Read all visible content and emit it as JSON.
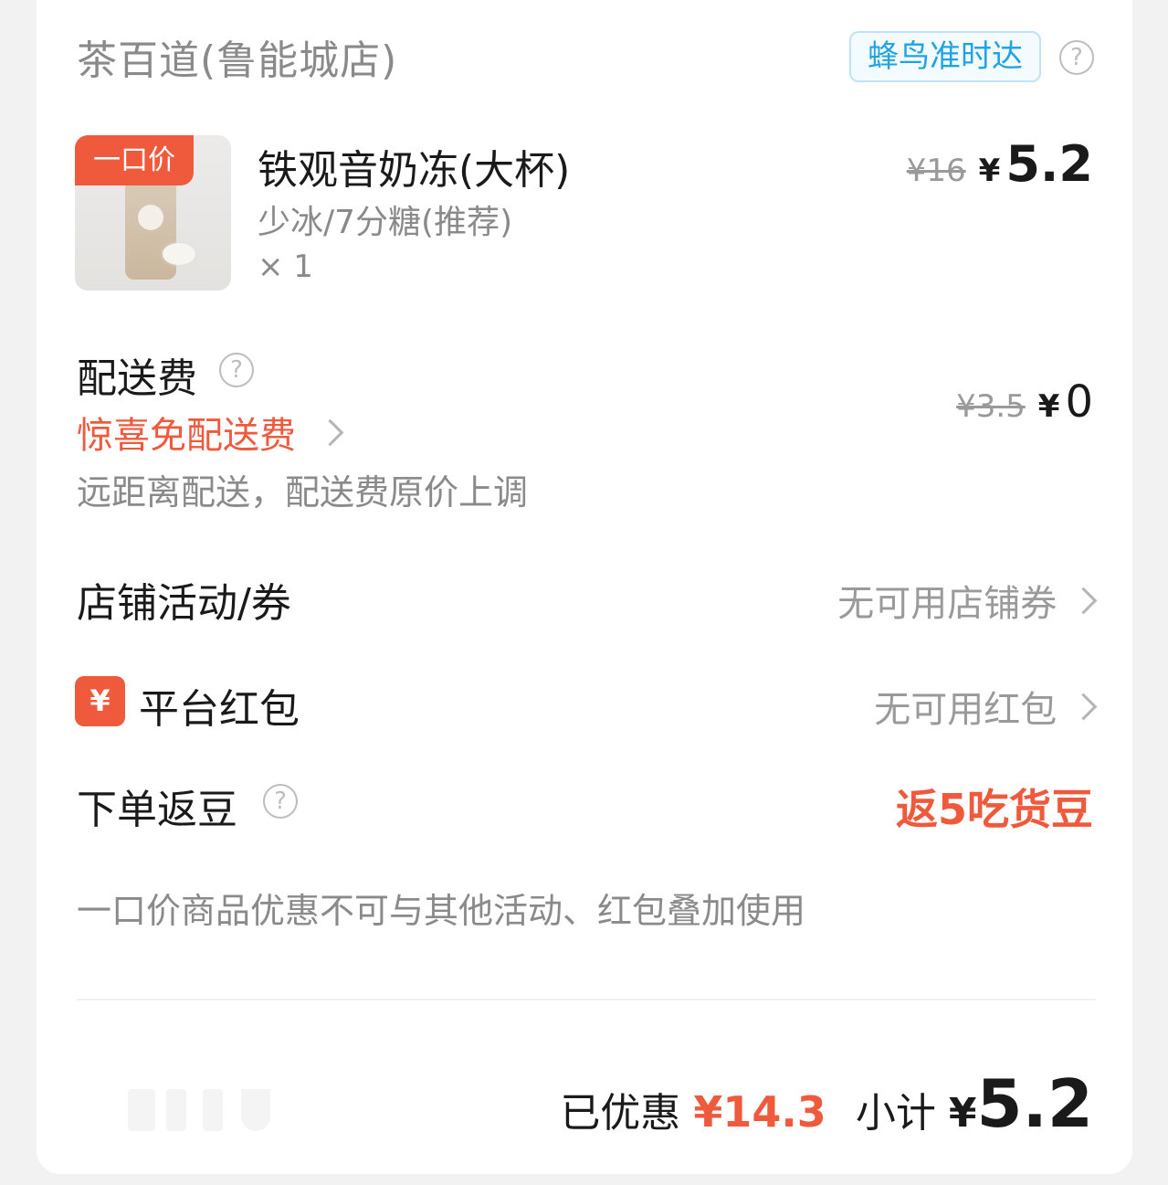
{
  "header": {
    "shop_name": "茶百道(鲁能城店)",
    "delivery_badge": "蜂鸟准时达",
    "help_icon": "?"
  },
  "product": {
    "tag": "一口价",
    "name": "铁观音奶冻(大杯)",
    "spec": "少冰/7分糖(推荐)",
    "qty": "× 1",
    "original_price": "¥16",
    "currency": "¥",
    "price": "5.2"
  },
  "delivery": {
    "title": "配送费",
    "promo": "惊喜免配送费",
    "note": "远距离配送，配送费原价上调",
    "original_fee": "¥3.5",
    "currency": "¥",
    "fee": "0"
  },
  "shop_coupon": {
    "title": "店铺活动/券",
    "value": "无可用店铺券"
  },
  "red_packet": {
    "icon_text": "¥",
    "title": "平台红包",
    "value": "无可用红包"
  },
  "beans": {
    "title": "下单返豆",
    "value": "返5吃货豆"
  },
  "rule_note": "一口价商品优惠不可与其他活动、红包叠加使用",
  "summary": {
    "discount_label": "已优惠",
    "discount_value": "¥14.3",
    "subtotal_label": "小计",
    "currency": "¥",
    "subtotal": "5.2"
  },
  "colors": {
    "accent": "#ef5a3c",
    "badge_blue": "#1fa3e6",
    "muted": "#8a8a8a"
  }
}
